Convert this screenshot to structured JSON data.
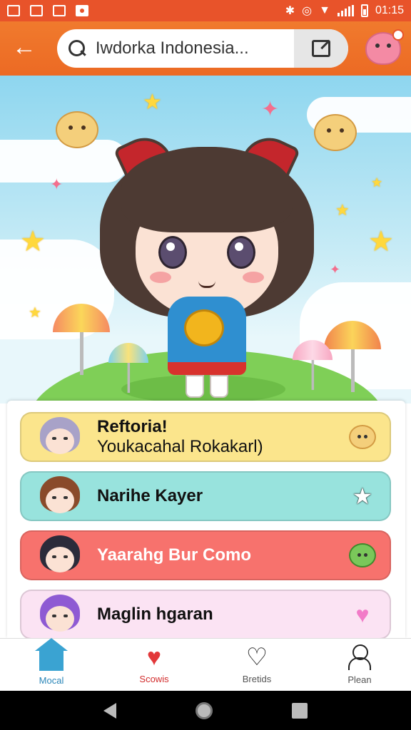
{
  "status_bar": {
    "time": "01:15"
  },
  "app_bar": {
    "back_icon": "arrow-left-icon",
    "search_text": "Iwdorka Indonesia...",
    "edit_icon": "edit-icon",
    "profile_icon": "pig-avatar-icon"
  },
  "list": {
    "items": [
      {
        "line1": "Reftoria!",
        "line2": "Youkacahal Rokakarl)",
        "bg": "#fbe58c",
        "text_color": "#111111",
        "icon": "hamster-icon"
      },
      {
        "line1": "Narihe Kayer",
        "line2": "",
        "bg": "#98e3dd",
        "text_color": "#111111",
        "icon": "star-icon"
      },
      {
        "line1": "Yaarahg Bur Como",
        "line2": "",
        "bg": "#f7726d",
        "text_color": "#ffffff",
        "icon": "green-cat-icon"
      },
      {
        "line1": "Maglin hgaran",
        "line2": "",
        "bg": "#fbe3f3",
        "text_color": "#111111",
        "icon": "heart-icon"
      }
    ]
  },
  "bottom_nav": {
    "items": [
      {
        "label": "Mocal",
        "icon": "home-icon"
      },
      {
        "label": "Scowis",
        "icon": "heart-icon"
      },
      {
        "label": "Bretids",
        "icon": "heart-outline-icon"
      },
      {
        "label": "Plean",
        "icon": "person-icon"
      }
    ]
  },
  "colors": {
    "accent": "#ec6a24",
    "active_nav": "#2a86b8"
  }
}
